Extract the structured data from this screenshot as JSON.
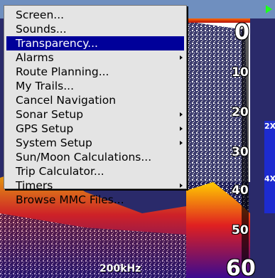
{
  "colors": {
    "menu_bg": "#e4e4e4",
    "selection": "#00009a",
    "zoom_bar": "#1d2bd0",
    "status_arrow": "#1eff1e"
  },
  "menu": {
    "items": [
      {
        "label": "Screen...",
        "submenu": false
      },
      {
        "label": "Sounds...",
        "submenu": false
      },
      {
        "label": "Transparency...",
        "submenu": false,
        "selected": true
      },
      {
        "label": "Alarms",
        "submenu": true
      },
      {
        "label": "Route Planning...",
        "submenu": false
      },
      {
        "label": "My Trails...",
        "submenu": false
      },
      {
        "label": "Cancel Navigation",
        "submenu": false
      },
      {
        "label": "Sonar Setup",
        "submenu": true
      },
      {
        "label": "GPS Setup",
        "submenu": true
      },
      {
        "label": "System Setup",
        "submenu": true
      },
      {
        "label": "Sun/Moon Calculations...",
        "submenu": false
      },
      {
        "label": "Trip Calculator...",
        "submenu": false
      },
      {
        "label": "Timers",
        "submenu": true
      },
      {
        "label": "Browse MMC Files...",
        "submenu": false
      }
    ]
  },
  "sonar": {
    "depth_labels": [
      "0",
      "10",
      "20",
      "30",
      "40",
      "50",
      "60"
    ],
    "zoom_buttons": [
      "2X",
      "4X"
    ],
    "frequency": "200kHz"
  },
  "icons": {
    "status_arrow": "play-arrow-icon",
    "submenu_arrow": "caret-right-icon"
  }
}
